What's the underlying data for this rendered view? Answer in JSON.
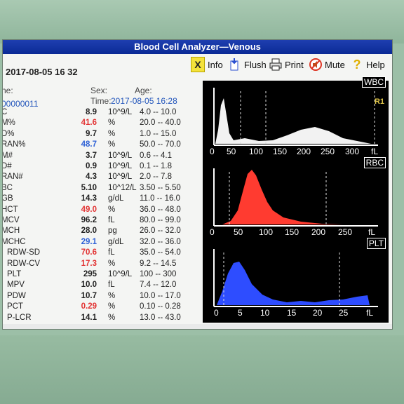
{
  "window": {
    "title": "Blood Cell Analyzer—Venous"
  },
  "header": {
    "date_time": "2017-08-05  16  32"
  },
  "toolbar": {
    "info_label": "Info",
    "flush_label": "Flush",
    "print_label": "Print",
    "mute_label": "Mute",
    "help_label": "Help"
  },
  "patient": {
    "name_label": "ne:",
    "sex_label": "Sex:",
    "age_label": "Age:",
    "id_value": "00000011",
    "time_label": "Time:",
    "time_value": "2017-08-05 16:28"
  },
  "params": [
    {
      "name": "C",
      "value": "8.9",
      "unit": "10^9/L",
      "range": "4.0  --  10.0",
      "flag": ""
    },
    {
      "name": "M%",
      "value": "41.6",
      "unit": "%",
      "range": "20.0  --  40.0",
      "flag": "high"
    },
    {
      "name": "D%",
      "value": "9.7",
      "unit": "%",
      "range": "1.0  --  15.0",
      "flag": ""
    },
    {
      "name": "RAN%",
      "value": "48.7",
      "unit": "%",
      "range": "50.0  --  70.0",
      "flag": "low"
    },
    {
      "name": "M#",
      "value": "3.7",
      "unit": "10^9/L",
      "range": "0.6  --  4.1",
      "flag": ""
    },
    {
      "name": "D#",
      "value": "0.9",
      "unit": "10^9/L",
      "range": "0.1  --  1.8",
      "flag": ""
    },
    {
      "name": "RAN#",
      "value": "4.3",
      "unit": "10^9/L",
      "range": "2.0  --  7.8",
      "flag": ""
    },
    {
      "name": "BC",
      "value": "5.10",
      "unit": "10^12/L",
      "range": "3.50  --  5.50",
      "flag": ""
    },
    {
      "name": "GB",
      "value": "14.3",
      "unit": "g/dL",
      "range": "11.0  --  16.0",
      "flag": ""
    },
    {
      "name": "HCT",
      "value": "49.0",
      "unit": "%",
      "range": "36.0  --  48.0",
      "flag": "high"
    },
    {
      "name": "MCV",
      "value": "96.2",
      "unit": "fL",
      "range": "80.0  --  99.0",
      "flag": ""
    },
    {
      "name": "MCH",
      "value": "28.0",
      "unit": "pg",
      "range": "26.0  --  32.0",
      "flag": ""
    },
    {
      "name": "MCHC",
      "value": "29.1",
      "unit": "g/dL",
      "range": "32.0  --  36.0",
      "flag": "low"
    },
    {
      "name": "RDW-SD",
      "value": "70.6",
      "unit": "fL",
      "range": "35.0  --  54.0",
      "flag": "high"
    },
    {
      "name": "RDW-CV",
      "value": "17.3",
      "unit": "%",
      "range": "9.2  --  14.5",
      "flag": "high"
    },
    {
      "name": "PLT",
      "value": "295",
      "unit": "10^9/L",
      "range": "100  --  300",
      "flag": ""
    },
    {
      "name": "MPV",
      "value": "10.0",
      "unit": "fL",
      "range": "7.4  --  12.0",
      "flag": ""
    },
    {
      "name": "PDW",
      "value": "10.7",
      "unit": "%",
      "range": "10.0  --  17.0",
      "flag": ""
    },
    {
      "name": "PCT",
      "value": "0.29",
      "unit": "%",
      "range": "0.10  --  0.28",
      "flag": "high"
    },
    {
      "name": "P-LCR",
      "value": "14.1",
      "unit": "%",
      "range": "13.0  --  43.0",
      "flag": ""
    }
  ],
  "histograms": {
    "wbc": {
      "label": "WBC",
      "marker": "R1",
      "ticks": [
        "0",
        "50",
        "100",
        "150",
        "200",
        "250",
        "300",
        "fL"
      ],
      "color": "#f2f2f2"
    },
    "rbc": {
      "label": "RBC",
      "ticks": [
        "0",
        "50",
        "100",
        "150",
        "200",
        "250",
        "fL"
      ],
      "color": "#ff3b30"
    },
    "plt": {
      "label": "PLT",
      "ticks": [
        "0",
        "5",
        "10",
        "15",
        "20",
        "25",
        "fL"
      ],
      "color": "#2e4dff"
    }
  }
}
